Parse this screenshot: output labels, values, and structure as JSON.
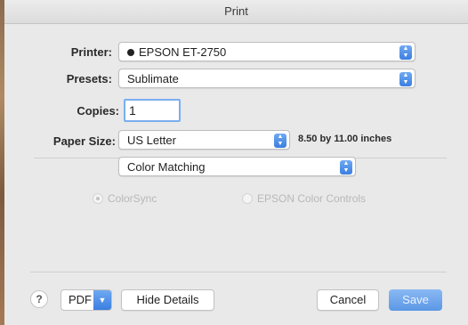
{
  "window": {
    "title": "Print"
  },
  "printer": {
    "label": "Printer:",
    "value": "EPSON ET-2750"
  },
  "presets": {
    "label": "Presets:",
    "value": "Sublimate"
  },
  "copies": {
    "label": "Copies:",
    "value": "1"
  },
  "paper_size": {
    "label": "Paper Size:",
    "value": "US Letter",
    "dimensions": "8.50 by 11.00 inches"
  },
  "section_menu": {
    "value": "Color Matching"
  },
  "color_options": [
    {
      "label": "ColorSync",
      "selected": true
    },
    {
      "label": "EPSON Color Controls",
      "selected": false
    }
  ],
  "footer": {
    "help": "?",
    "pdf_label": "PDF",
    "hide_details": "Hide Details",
    "cancel": "Cancel",
    "save": "Save"
  },
  "colors": {
    "accent": "#3b7ee0",
    "background": "#e9e9e9"
  }
}
